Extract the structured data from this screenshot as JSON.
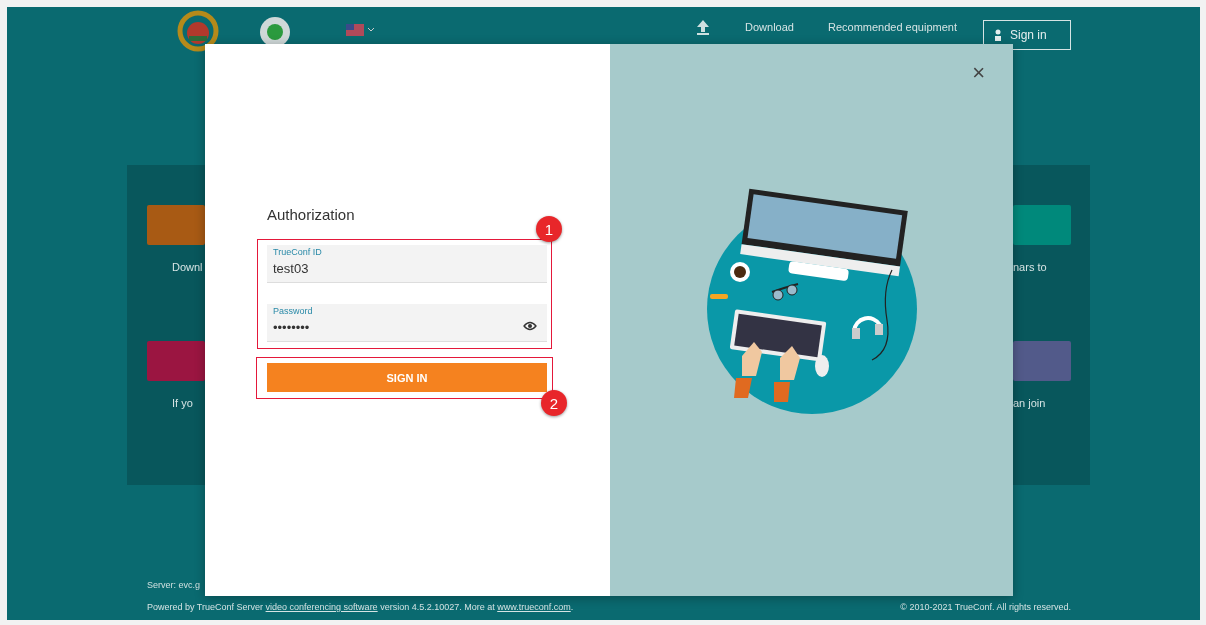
{
  "header": {
    "nav": [
      "Download",
      "Recommended equipment"
    ],
    "sign_in": "Sign in"
  },
  "background_cards": {
    "left": [
      {
        "color": "#a85a14",
        "caption": "Downl"
      },
      {
        "color": "#9b1541",
        "caption": "If yo"
      }
    ],
    "right": [
      {
        "color": "#00897b",
        "caption": "nars to"
      },
      {
        "color": "#525a8a",
        "caption": "an join"
      }
    ]
  },
  "server": "Server: evc.g",
  "footer": {
    "prefix": "Powered by TrueConf Server ",
    "link1": "video conferencing software",
    "middle": " version 4.5.2.10027. More at ",
    "link2": "www.trueconf.com",
    "suffix": ".",
    "copyright": "© 2010-2021 TrueConf. All rights reserved."
  },
  "dialog": {
    "title": "Authorization",
    "close": "×",
    "submit": "SIGN IN",
    "fields": [
      {
        "kind": "text",
        "label": "TrueConf ID",
        "value": "test03"
      },
      {
        "kind": "password",
        "label": "Password",
        "value": "••••••••"
      }
    ]
  },
  "annotations": [
    {
      "number": "1"
    },
    {
      "number": "2"
    }
  ]
}
